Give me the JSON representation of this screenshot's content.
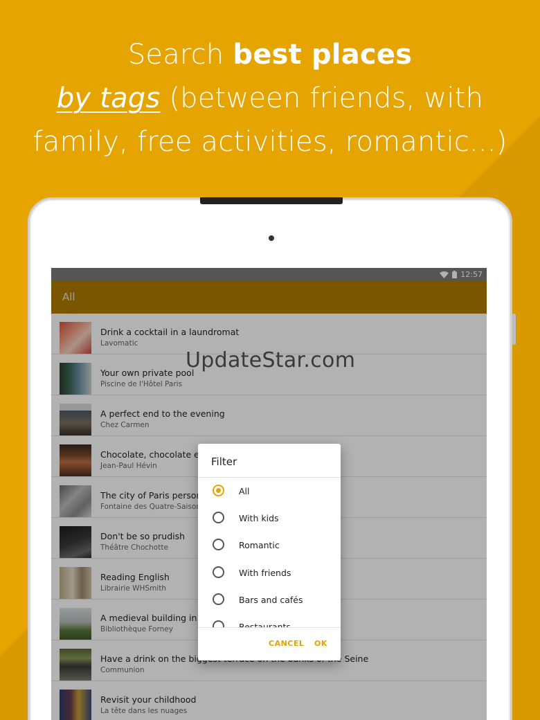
{
  "headline": {
    "l1_pre": "Search ",
    "l1_bold": "best places",
    "l2_u": "by tags",
    "l2_rest": " (between friends, with",
    "l3": "family, free activities, romantic...)"
  },
  "status": {
    "time": "12:57"
  },
  "appbar": {
    "title": "All"
  },
  "places": [
    {
      "title": "Drink a cocktail in a laundromat",
      "subtitle": "Lavomatic"
    },
    {
      "title": "Your own private pool",
      "subtitle": "Piscine de l'Hôtel Paris"
    },
    {
      "title": "A perfect end to the evening",
      "subtitle": "Chez Carmen"
    },
    {
      "title": "Chocolate, chocolate eve",
      "subtitle": "Jean-Paul Hévin"
    },
    {
      "title": "The city of Paris personi",
      "subtitle": "Fontaine des Quatre-Saison"
    },
    {
      "title": "Don't be so prudish",
      "subtitle": "Théâtre Chochotte"
    },
    {
      "title": "Reading English",
      "subtitle": "Librairie WHSmith"
    },
    {
      "title": "A medieval building in Le",
      "subtitle": "Bibliothèque Forney"
    },
    {
      "title": "Have a drink on the biggest terrace on the banks of the Seine",
      "subtitle": "Communion"
    },
    {
      "title": "Revisit your childhood",
      "subtitle": "La tête dans les nuages"
    }
  ],
  "dialog": {
    "title": "Filter",
    "options": [
      "All",
      "With kids",
      "Romantic",
      "With friends",
      "Bars and cafés",
      "Restaurants"
    ],
    "selected": "All",
    "cancel": "CANCEL",
    "ok": "OK"
  },
  "watermark": "UpdateStar.com",
  "colors": {
    "accent": "#E5A400",
    "appbar": "#B07C00",
    "statusbar": "#7a7a7a"
  }
}
